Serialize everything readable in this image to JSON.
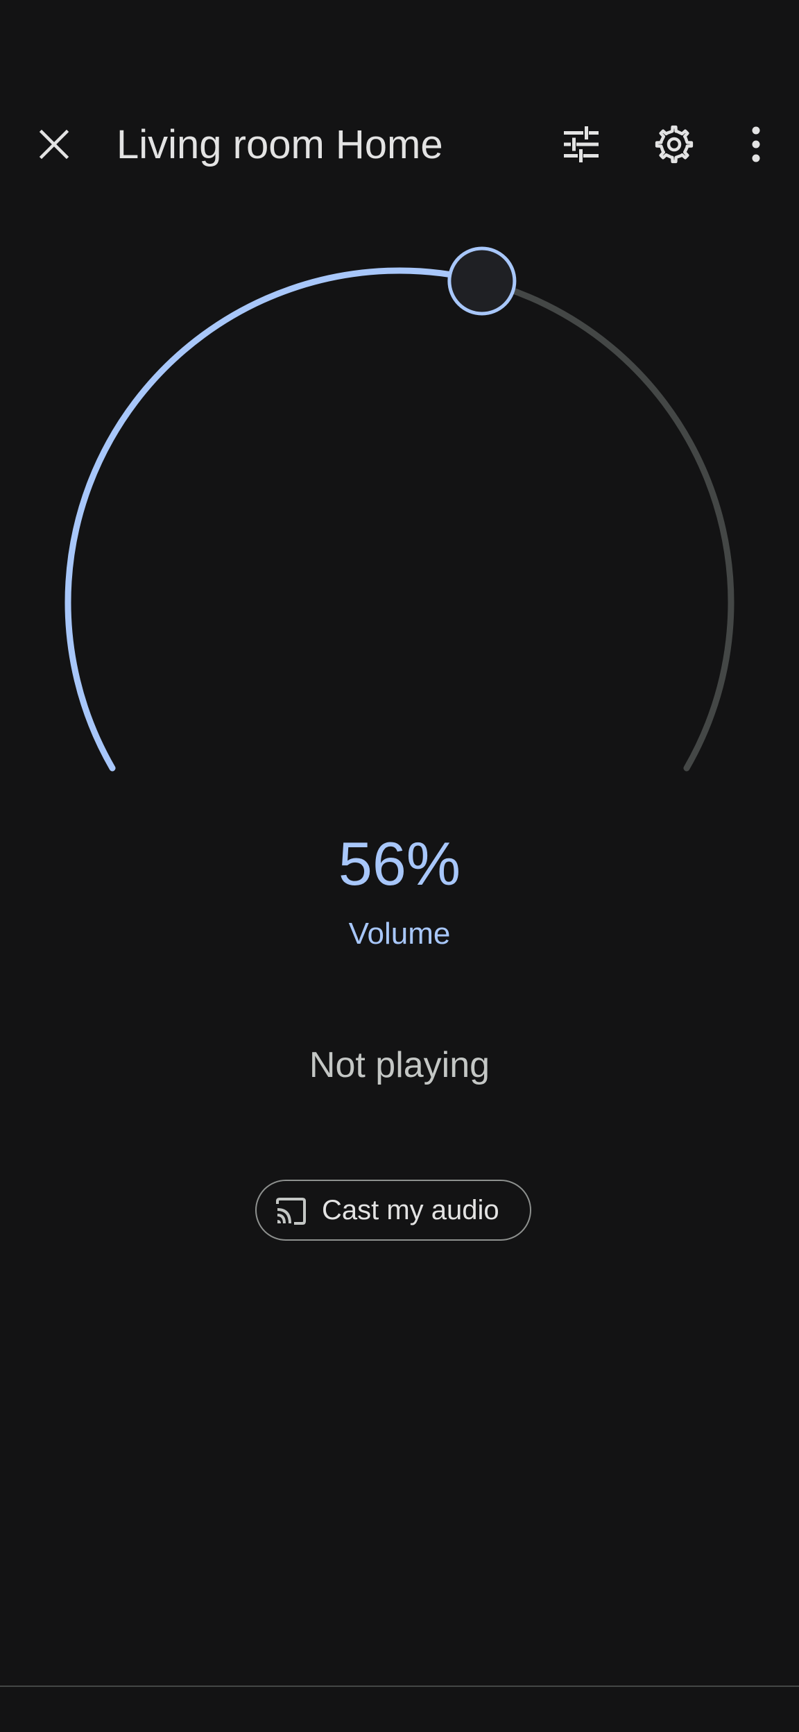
{
  "header": {
    "title": "Living room Home",
    "close_icon": "close-icon",
    "tune_icon": "tune-icon",
    "settings_icon": "gear-icon",
    "more_icon": "more-vert-icon"
  },
  "volume": {
    "percent_text": "56%",
    "level": 0.56,
    "label": "Volume"
  },
  "playback": {
    "status": "Not playing"
  },
  "cast_button": {
    "label": "Cast my audio",
    "icon": "cast-icon"
  },
  "colors": {
    "background": "#131314",
    "accent": "#a8c7fa",
    "track": "#444746",
    "text": "#e3e3e3"
  }
}
